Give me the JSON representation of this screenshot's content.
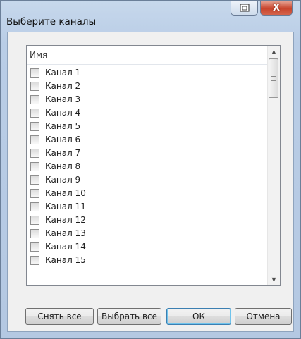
{
  "window": {
    "title": "Выберите каналы",
    "restore_icon": "window-restore-icon",
    "close_glyph": "X"
  },
  "list": {
    "column_header": "Имя",
    "items": [
      {
        "label": "Канал 1",
        "checked": false
      },
      {
        "label": "Канал 2",
        "checked": false
      },
      {
        "label": "Канал 3",
        "checked": false
      },
      {
        "label": "Канал 4",
        "checked": false
      },
      {
        "label": "Канал 5",
        "checked": false
      },
      {
        "label": "Канал 6",
        "checked": false
      },
      {
        "label": "Канал 7",
        "checked": false
      },
      {
        "label": "Канал 8",
        "checked": false
      },
      {
        "label": "Канал 9",
        "checked": false
      },
      {
        "label": "Канал 10",
        "checked": false
      },
      {
        "label": "Канал 11",
        "checked": false
      },
      {
        "label": "Канал 12",
        "checked": false
      },
      {
        "label": "Канал 13",
        "checked": false
      },
      {
        "label": "Канал 14",
        "checked": false
      },
      {
        "label": "Канал 15",
        "checked": false
      }
    ]
  },
  "buttons": {
    "clear_all": "Снять все",
    "select_all": "Выбрать все",
    "ok": "ОК",
    "cancel": "Отмена"
  },
  "colors": {
    "frame": "#b9cde6",
    "close_button": "#c8452d",
    "default_button_border": "#3c7fb1"
  }
}
